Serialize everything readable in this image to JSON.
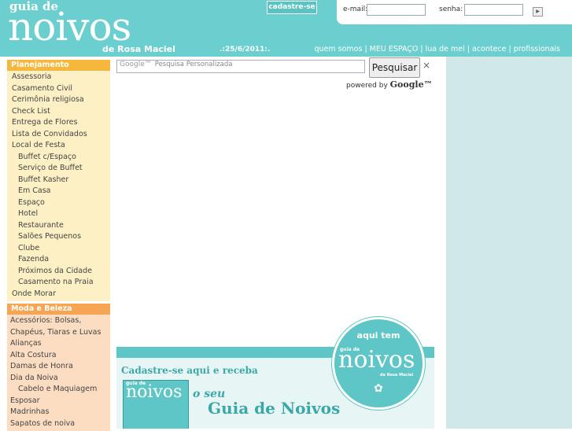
{
  "header": {
    "logo_guia": "guia de",
    "logo_noivos": "noivos",
    "logo_rosa": "de Rosa Maciel",
    "cadastre_label": "cadastre-se",
    "date": ".:25/6/2011:.",
    "nav": [
      "quem somos",
      "MEU ESPAÇO",
      "lua de mel",
      "acontece",
      "profissionais"
    ],
    "nav_separator": "|"
  },
  "login": {
    "email_label": "e-mail:",
    "senha_label": "senha:",
    "email_value": "",
    "senha_value": ""
  },
  "sidebar": {
    "planejamento": {
      "title": "Planejamento",
      "items": [
        {
          "label": "Assessoria",
          "sub": false
        },
        {
          "label": "Casamento Civil",
          "sub": false
        },
        {
          "label": "Cerimônia religiosa",
          "sub": false
        },
        {
          "label": "Check List",
          "sub": false
        },
        {
          "label": "Entrega de Flores",
          "sub": false
        },
        {
          "label": "Lista de Convidados",
          "sub": false
        },
        {
          "label": "Local de Festa",
          "sub": false
        },
        {
          "label": "Buffet c/Espaço",
          "sub": true
        },
        {
          "label": "Serviço de Buffet",
          "sub": true
        },
        {
          "label": "Buffet Kasher",
          "sub": true
        },
        {
          "label": "Em Casa",
          "sub": true
        },
        {
          "label": "Espaço",
          "sub": true
        },
        {
          "label": "Hotel",
          "sub": true
        },
        {
          "label": "Restaurante",
          "sub": true
        },
        {
          "label": "Salões Pequenos",
          "sub": true
        },
        {
          "label": "Clube",
          "sub": true
        },
        {
          "label": "Fazenda",
          "sub": true
        },
        {
          "label": "Próximos da Cidade",
          "sub": true
        },
        {
          "label": "Casamento na Praia",
          "sub": true
        },
        {
          "label": "Onde Morar",
          "sub": false
        }
      ]
    },
    "moda": {
      "title": "Moda e Beleza",
      "items": [
        {
          "label": "Acessórios: Bolsas,",
          "sub": false
        },
        {
          "label": "Chapéus, Tiaras e Luvas",
          "sub": false
        },
        {
          "label": "Alianças",
          "sub": false
        },
        {
          "label": "Alta Costura",
          "sub": false
        },
        {
          "label": "Damas de Honra",
          "sub": false
        },
        {
          "label": "Dia da Noiva",
          "sub": false
        },
        {
          "label": "Cabelo e Maquiagem",
          "sub": true
        },
        {
          "label": "Esposar",
          "sub": false
        },
        {
          "label": "Madrinhas",
          "sub": false
        },
        {
          "label": "Sapatos de noiva",
          "sub": false
        }
      ]
    }
  },
  "search": {
    "placeholder_logo": "Google™",
    "placeholder": "Pesquisa Personalizada",
    "button_label": "Pesquisar",
    "close_glyph": "×",
    "powered_by": "powered by",
    "powered_brand": "Google™"
  },
  "banner": {
    "cta": "Cadastre-se aqui e receba",
    "mag_guia": "guia de",
    "mag_noivos": "noivos",
    "o_seu": "o seu",
    "title": "Guia de Noivos"
  },
  "seal": {
    "aqui_tem": "aqui tem",
    "guia": "guia de",
    "noivos": "noivos",
    "rosa": "de Rosa Maciel",
    "flower_glyph": "✿"
  },
  "colors": {
    "header_teal": "#6ccfcf",
    "planejamento_head": "#f5b83c",
    "planejamento_body": "#fdf0c4",
    "moda_head": "#f5a553",
    "moda_body": "#fcddc2",
    "right_column": "#d0e8e8"
  }
}
